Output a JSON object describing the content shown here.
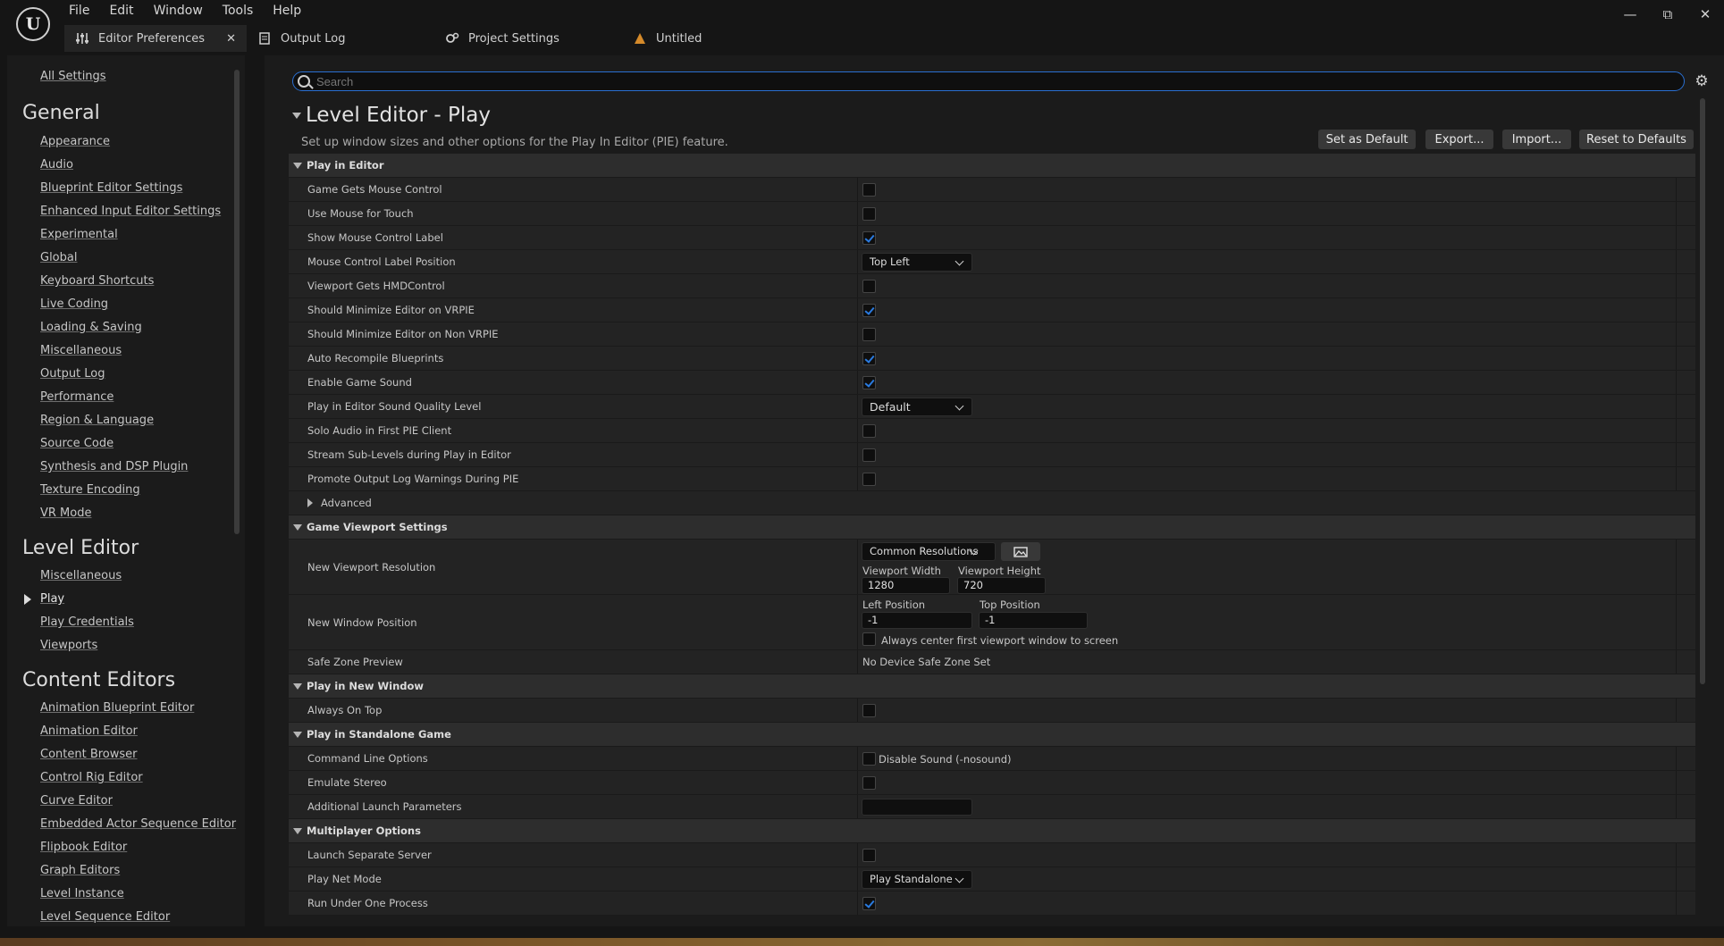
{
  "menu": [
    "File",
    "Edit",
    "Window",
    "Tools",
    "Help"
  ],
  "tabs": [
    {
      "label": "Editor Preferences",
      "icon": "sliders-icon",
      "active": true
    },
    {
      "label": "Output Log",
      "icon": "output-log-icon"
    },
    {
      "label": "Project Settings",
      "icon": "project-settings-icon"
    },
    {
      "label": "Untitled",
      "icon": "level-icon"
    }
  ],
  "sidebar": {
    "all_settings": "All Settings",
    "general_heading": "General",
    "general": [
      "Appearance",
      "Audio",
      "Blueprint Editor Settings",
      "Enhanced Input Editor Settings",
      "Experimental",
      "Global",
      "Keyboard Shortcuts",
      "Live Coding",
      "Loading & Saving",
      "Miscellaneous",
      "Output Log",
      "Performance",
      "Region & Language",
      "Source Code",
      "Synthesis and DSP Plugin",
      "Texture Encoding",
      "VR Mode"
    ],
    "level_editor_heading": "Level Editor",
    "level_editor": [
      "Miscellaneous",
      "Play",
      "Play Credentials",
      "Viewports"
    ],
    "content_editors_heading": "Content Editors",
    "content_editors": [
      "Animation Blueprint Editor",
      "Animation Editor",
      "Content Browser",
      "Control Rig Editor",
      "Curve Editor",
      "Embedded Actor Sequence Editor",
      "Flipbook Editor",
      "Graph Editors",
      "Level Instance",
      "Level Sequence Editor"
    ]
  },
  "search": {
    "placeholder": "Search"
  },
  "header": {
    "title": "Level Editor - Play",
    "description": "Set up window sizes and other options for the Play In Editor (PIE) feature.",
    "buttons": [
      "Set as Default",
      "Export...",
      "Import...",
      "Reset to Defaults"
    ]
  },
  "play_in_editor": {
    "title": "Play in Editor",
    "rows": [
      {
        "label": "Game Gets Mouse Control",
        "checked": false
      },
      {
        "label": "Use Mouse for Touch",
        "checked": false
      },
      {
        "label": "Show Mouse Control Label",
        "checked": true
      },
      {
        "label": "Mouse Control Label Position",
        "dropdown": "Top Left"
      },
      {
        "label": "Viewport Gets HMDControl",
        "checked": false
      },
      {
        "label": "Should Minimize Editor on VRPIE",
        "checked": true
      },
      {
        "label": "Should Minimize Editor on Non VRPIE",
        "checked": false
      },
      {
        "label": "Auto Recompile Blueprints",
        "checked": true
      },
      {
        "label": "Enable Game Sound",
        "checked": true
      },
      {
        "label": "Play in Editor Sound Quality Level",
        "dropdown": "Default"
      },
      {
        "label": "Solo Audio in First PIE Client",
        "checked": false
      },
      {
        "label": "Stream Sub-Levels during Play in Editor",
        "checked": false
      },
      {
        "label": "Promote Output Log Warnings During PIE",
        "checked": false
      }
    ],
    "advanced": "Advanced"
  },
  "game_viewport": {
    "title": "Game Viewport Settings",
    "resolution_label": "New Viewport Resolution",
    "common_resolutions": "Common Resolutions",
    "width_label": "Viewport Width",
    "height_label": "Viewport Height",
    "width": "1280",
    "height": "720",
    "window_position_label": "New Window Position",
    "left_label": "Left Position",
    "top_label": "Top Position",
    "left": "-1",
    "top": "-1",
    "center_label": "Always center first viewport window to screen",
    "center_checked": false,
    "safe_zone_label": "Safe Zone Preview",
    "safe_zone_value": "No Device Safe Zone Set"
  },
  "play_new_window": {
    "title": "Play in New Window",
    "always_on_top": "Always On Top",
    "always_on_top_checked": false
  },
  "standalone": {
    "title": "Play in Standalone Game",
    "cmd_label": "Command Line Options",
    "cmd_option": "Disable Sound (-nosound)",
    "cmd_checked": false,
    "emulate_stereo": "Emulate Stereo",
    "emulate_checked": false,
    "launch_params": "Additional Launch Parameters"
  },
  "multiplayer": {
    "title": "Multiplayer Options",
    "launch_server": "Launch Separate Server",
    "launch_server_checked": false,
    "net_mode_label": "Play Net Mode",
    "net_mode_value": "Play Standalone",
    "one_process": "Run Under One Process",
    "one_process_checked": true
  }
}
